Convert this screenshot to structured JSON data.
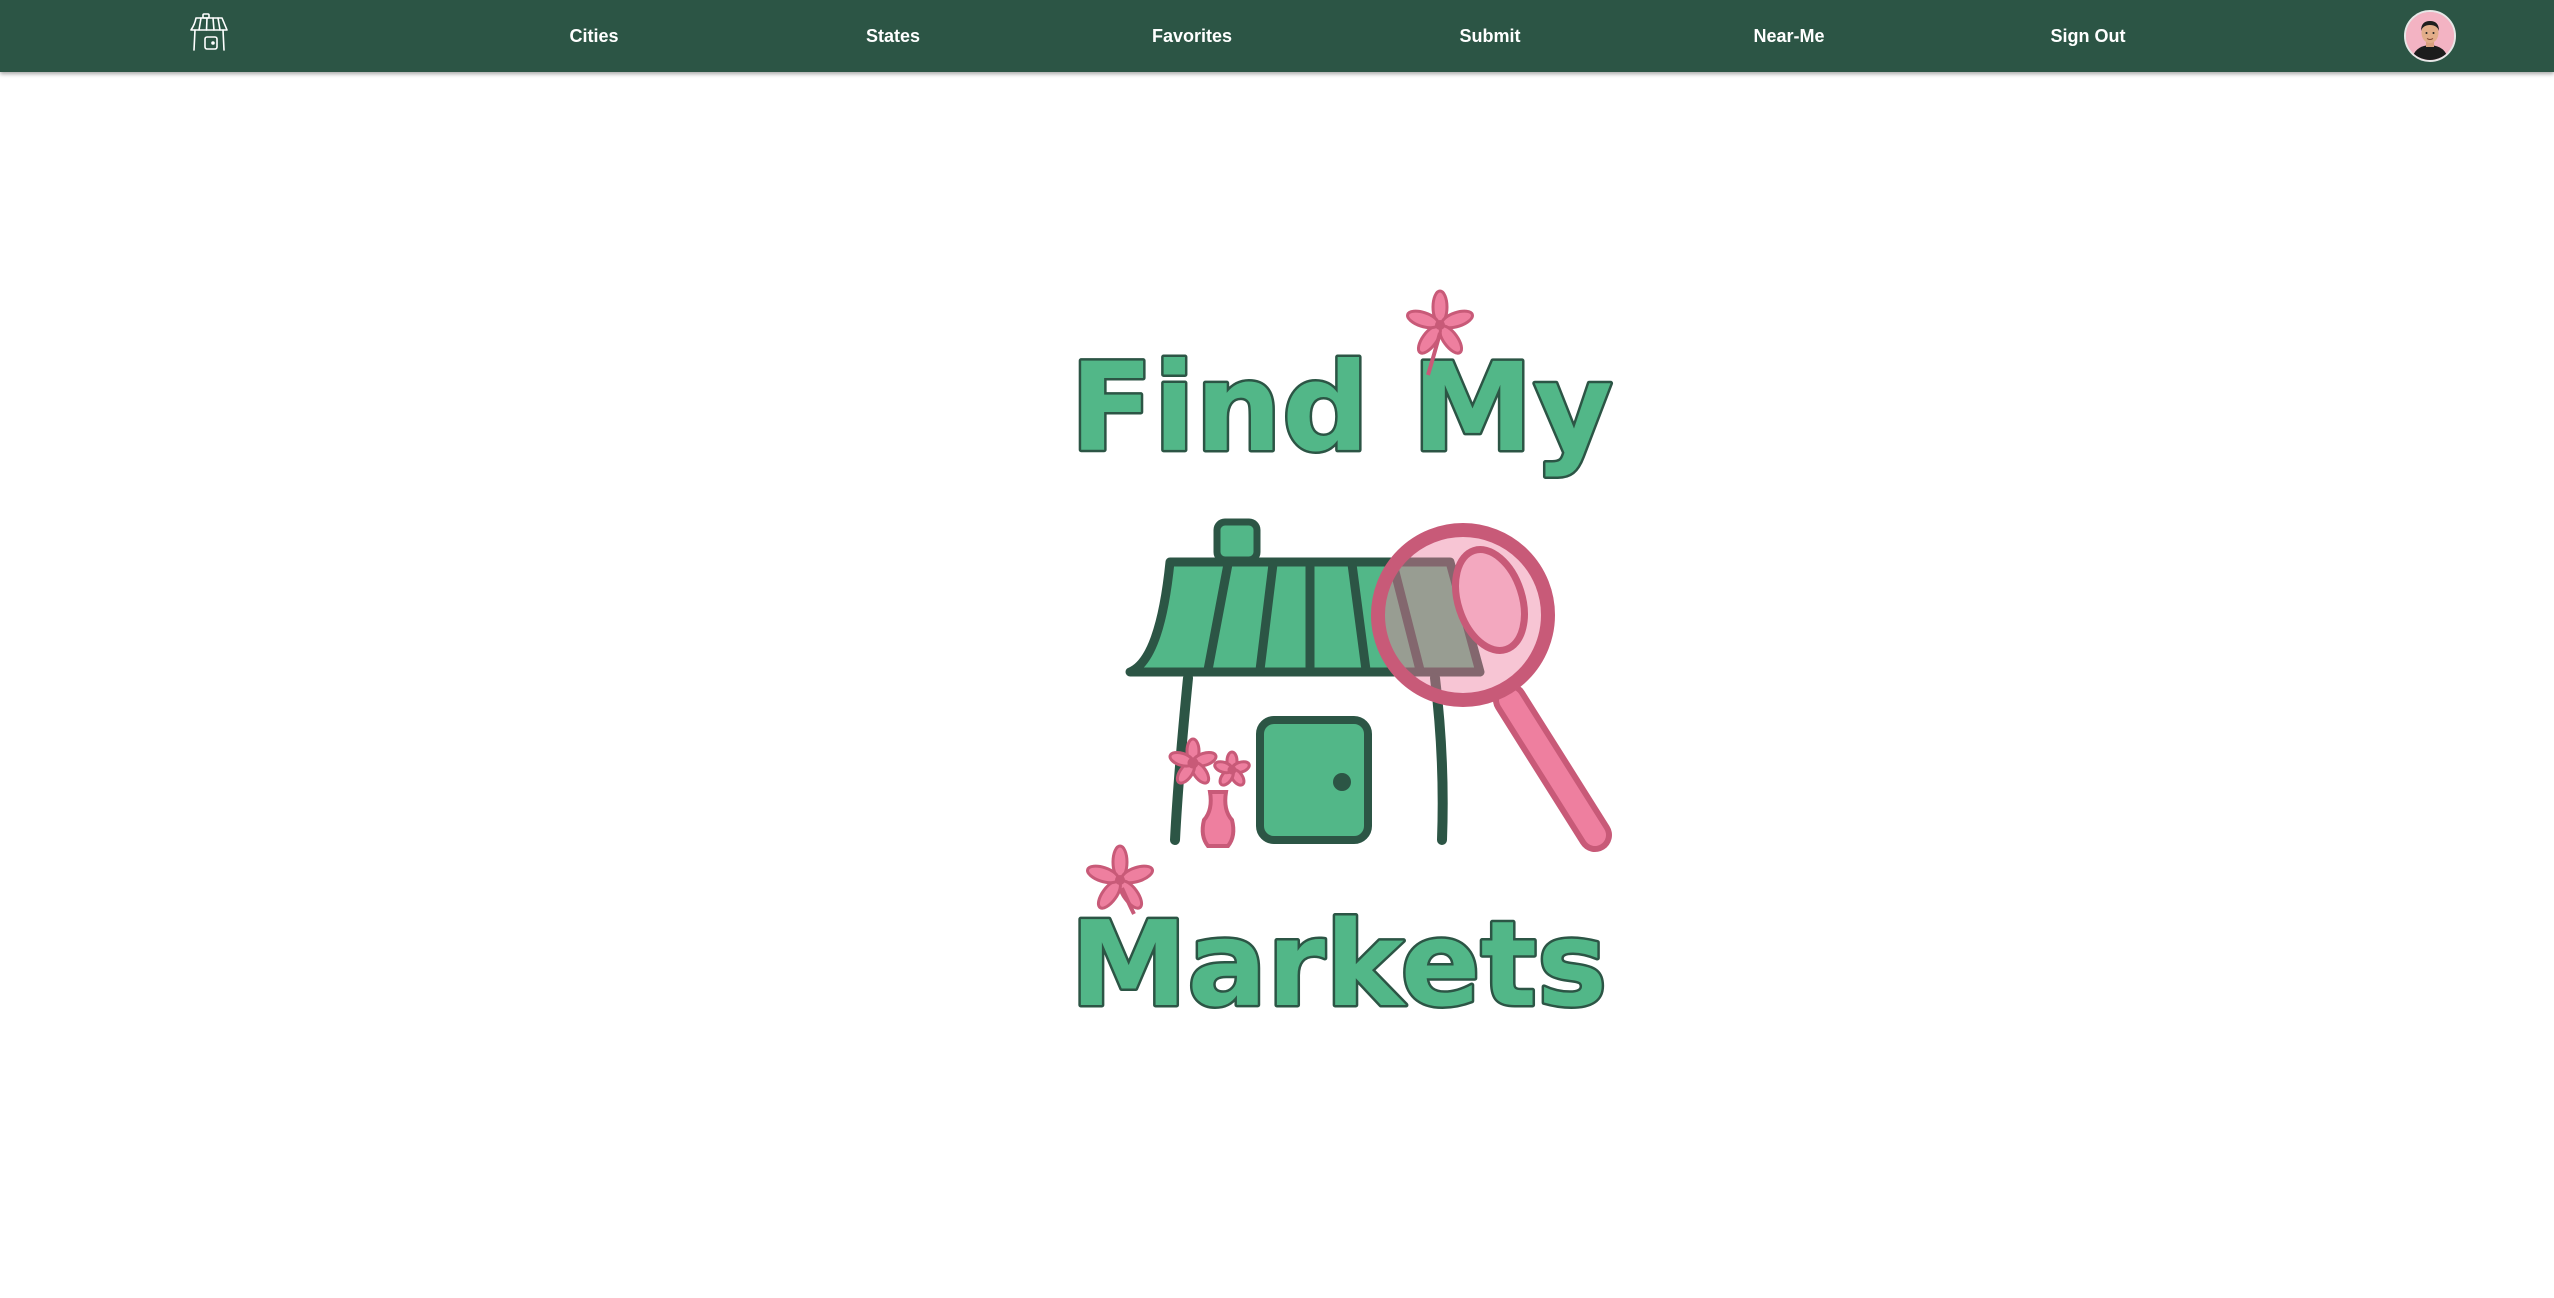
{
  "nav": {
    "logo_icon": "market-stall-icon",
    "links": [
      {
        "label": "Cities"
      },
      {
        "label": "States"
      },
      {
        "label": "Favorites"
      },
      {
        "label": "Submit"
      },
      {
        "label": "Near-Me"
      },
      {
        "label": "Sign Out"
      }
    ],
    "avatar_icon": "user-avatar-icon"
  },
  "hero": {
    "logo_line1": "Find My",
    "logo_line2": "Markets",
    "illustration": "market-stall-with-magnifier-illustration"
  },
  "colors": {
    "navbar": "#2c5545",
    "brand_green": "#52b788",
    "outline_dark": "#2c5545",
    "brand_pink": "#ee7f9f",
    "pink_outline": "#c85a78",
    "background": "#ffffff"
  }
}
